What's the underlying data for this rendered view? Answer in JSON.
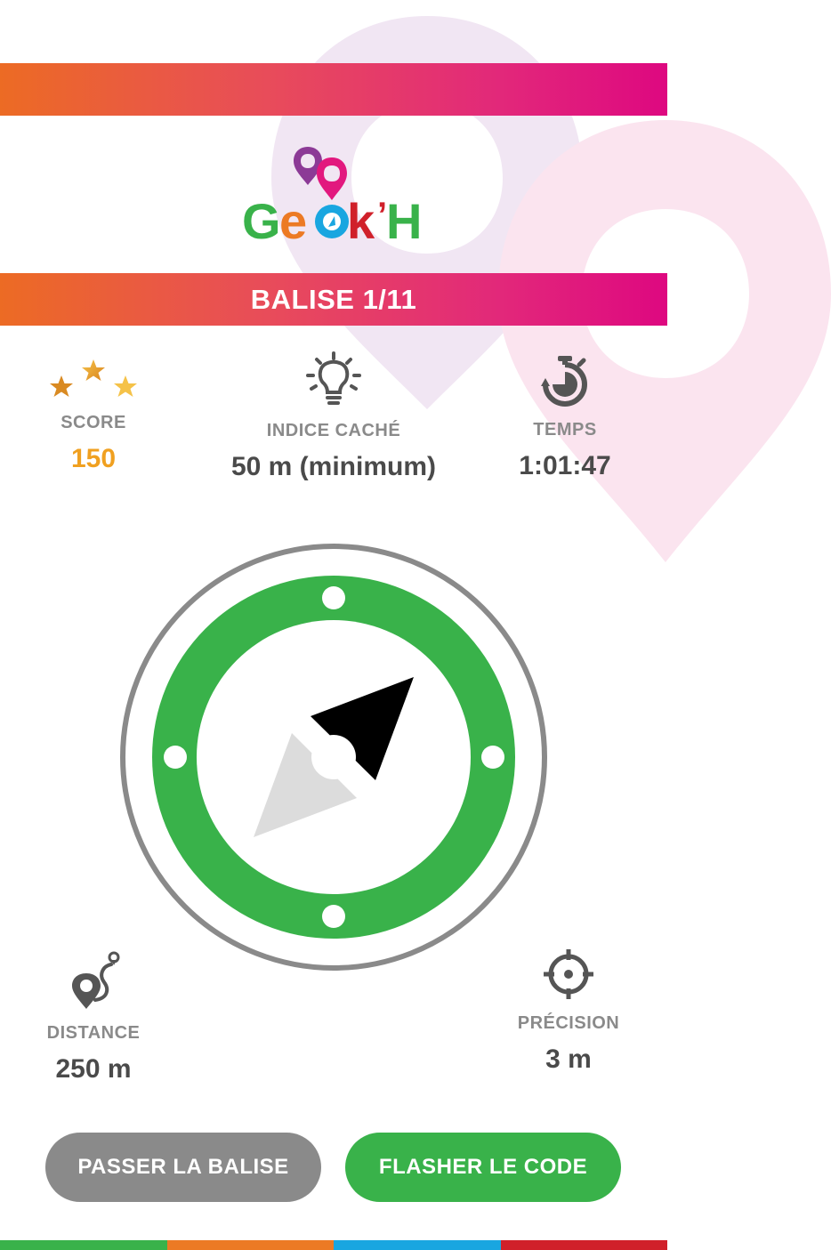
{
  "brand": {
    "logo_text": "Geok'H",
    "gradient_start": "#ec6b24",
    "gradient_end": "#de0880"
  },
  "header": {
    "balise_title": "BALISE 1/11"
  },
  "stats": {
    "score": {
      "label": "SCORE",
      "value": "150",
      "icon": "stars-icon"
    },
    "hint": {
      "label": "INDICE CACHÉ",
      "value": "50 m (minimum)",
      "icon": "lightbulb-icon"
    },
    "time": {
      "label": "TEMPS",
      "value": "1:01:47",
      "icon": "stopwatch-icon"
    }
  },
  "compass": {
    "ring_color": "#39b24a",
    "outer_ring_color": "#8a8a8a",
    "icon": "compass-icon"
  },
  "measures": {
    "distance": {
      "label": "DISTANCE",
      "value": "250 m",
      "icon": "route-icon"
    },
    "precision": {
      "label": "PRÉCISION",
      "value": "3 m",
      "icon": "crosshair-icon"
    }
  },
  "actions": {
    "skip_label": "PASSER LA BALISE",
    "scan_label": "FLASHER LE CODE"
  },
  "bottom_bar_colors": [
    "#39b24a",
    "#ec7a24",
    "#19a6e0",
    "#d0202a"
  ]
}
